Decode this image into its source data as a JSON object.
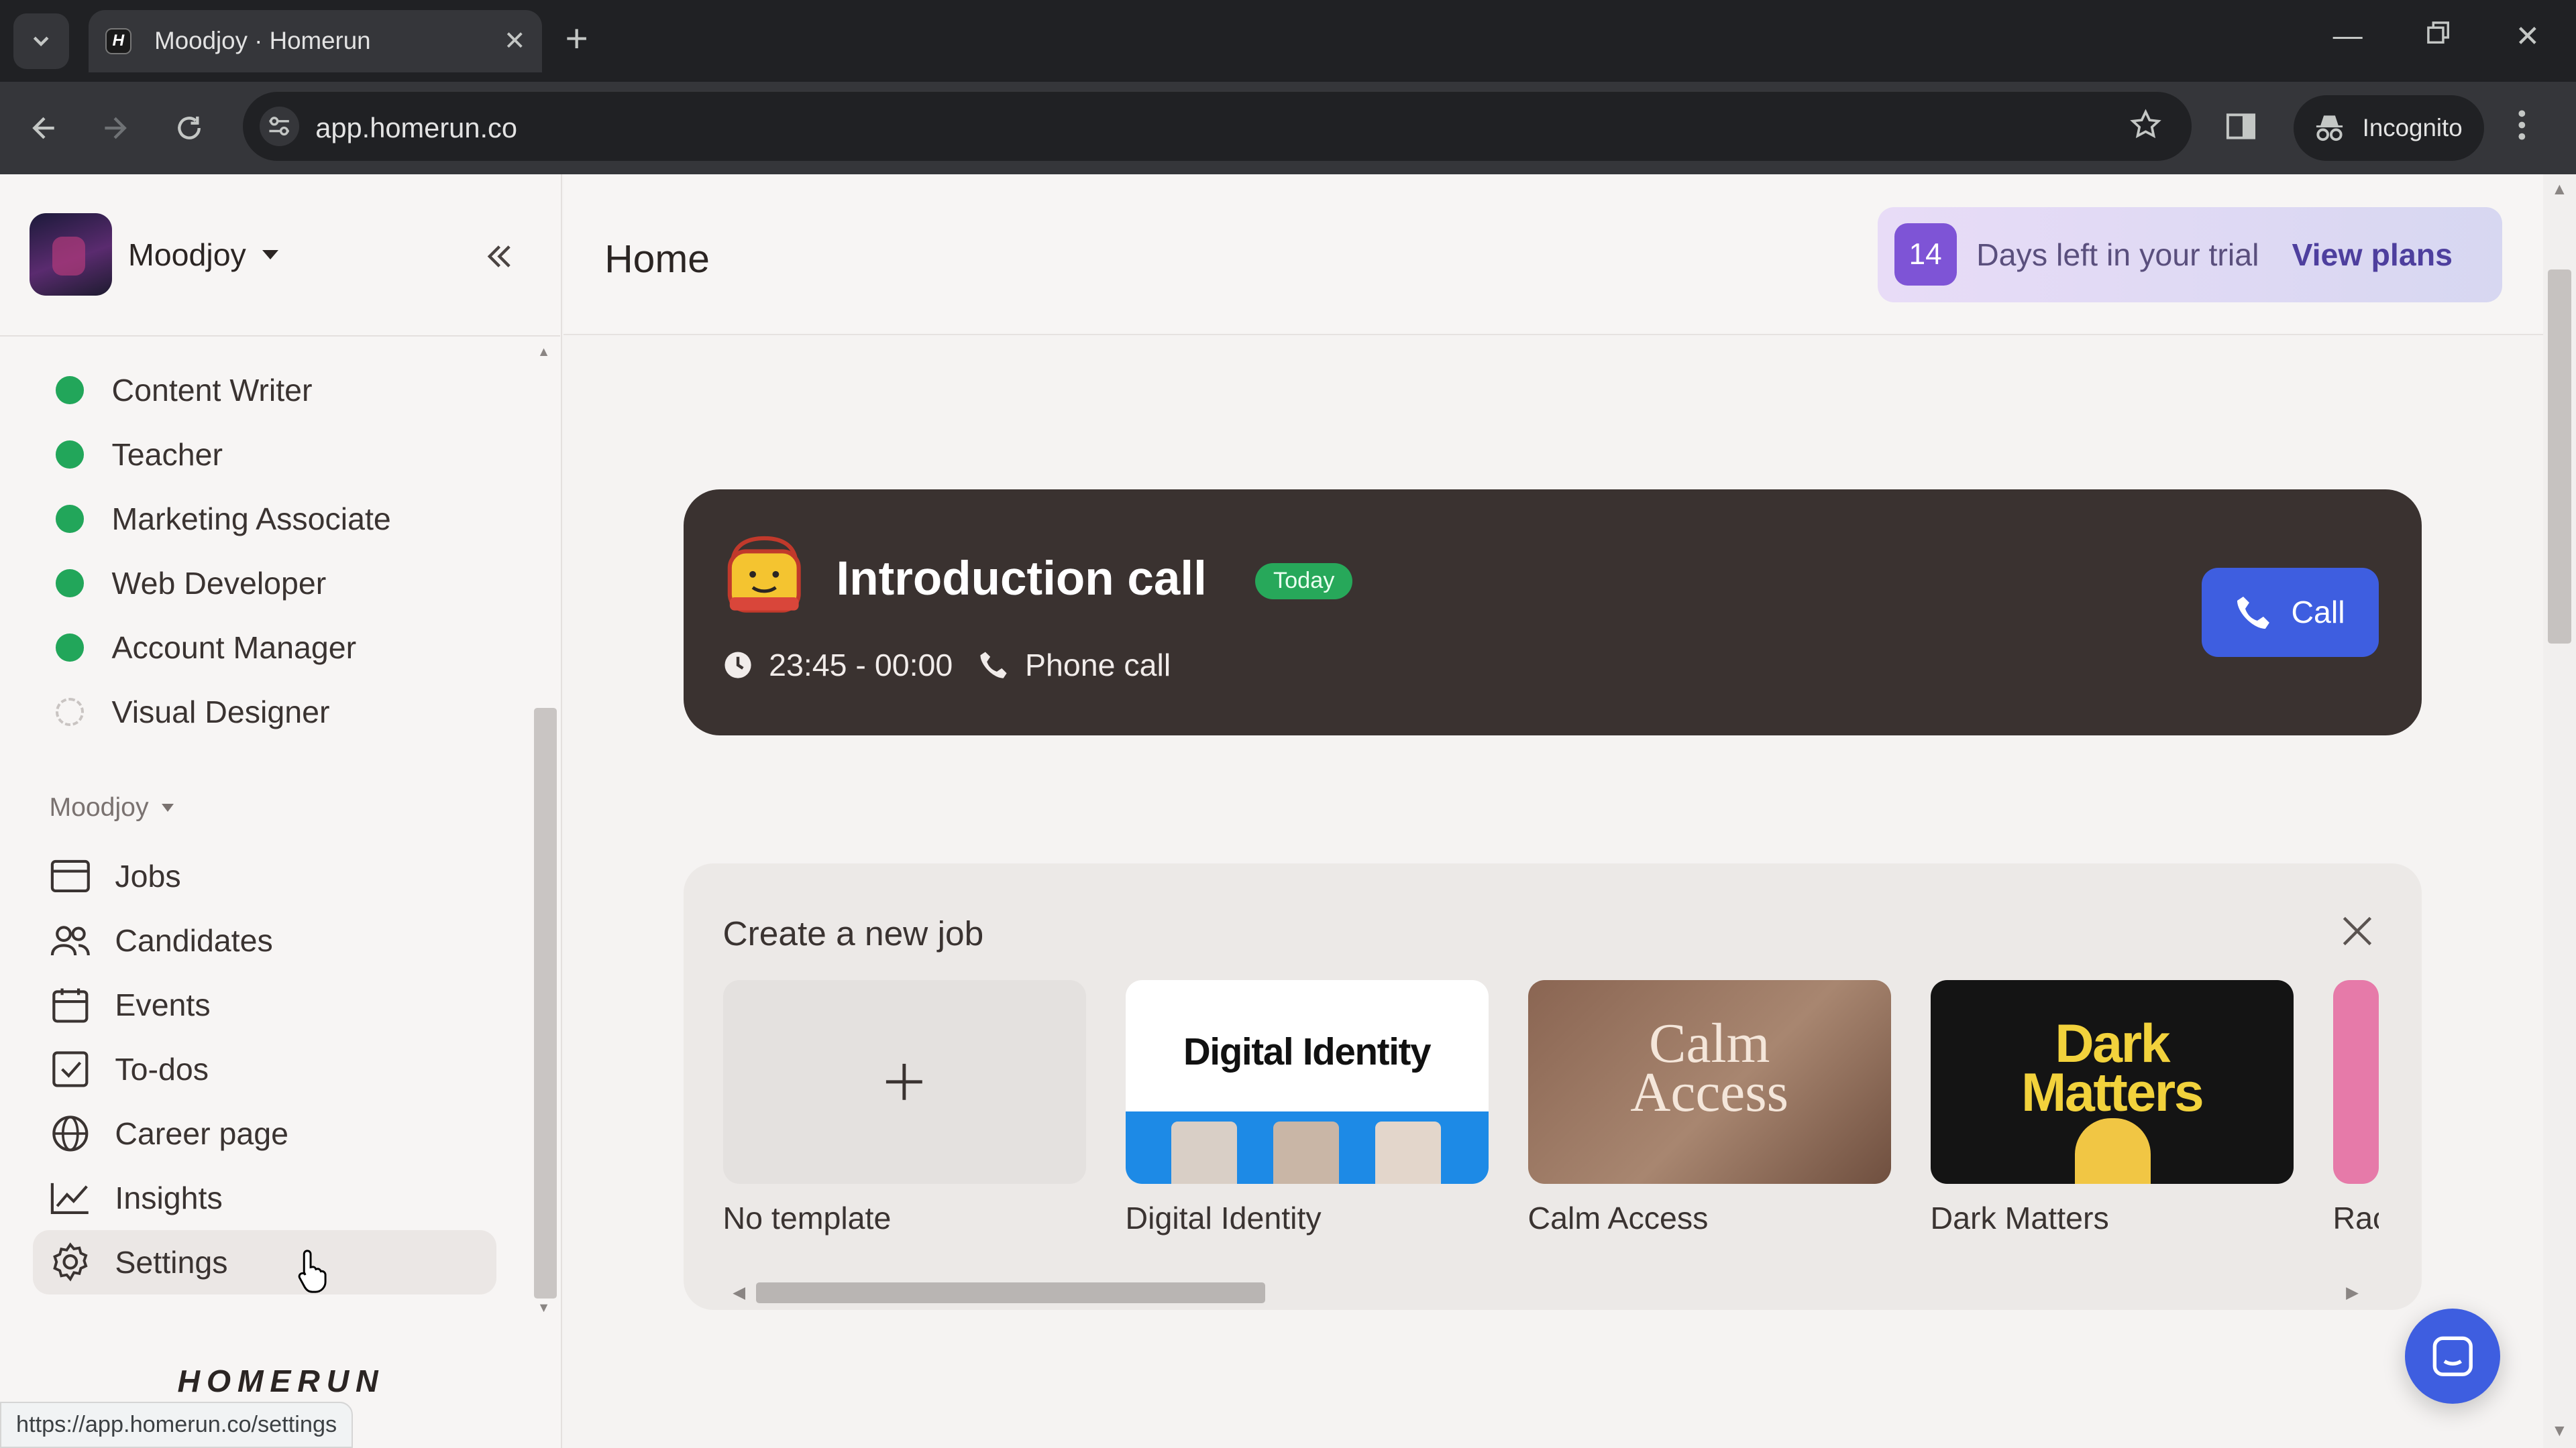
{
  "browser": {
    "tab_title": "Moodjoy · Homerun",
    "favicon_letter": "H",
    "url": "app.homerun.co",
    "incognito_label": "Incognito",
    "status_url": "https://app.homerun.co/settings"
  },
  "sidebar": {
    "workspace_name": "Moodjoy",
    "jobs": [
      {
        "label": "Content Writer",
        "status": "published"
      },
      {
        "label": "Teacher",
        "status": "published"
      },
      {
        "label": "Marketing Associate",
        "status": "published"
      },
      {
        "label": "Web Developer",
        "status": "published"
      },
      {
        "label": "Account Manager",
        "status": "published"
      },
      {
        "label": "Visual Designer",
        "status": "draft"
      }
    ],
    "group_label": "Moodjoy",
    "nav": [
      {
        "label": "Jobs",
        "icon": "jobs-icon"
      },
      {
        "label": "Candidates",
        "icon": "candidates-icon"
      },
      {
        "label": "Events",
        "icon": "calendar-icon"
      },
      {
        "label": "To-dos",
        "icon": "checkbox-icon"
      },
      {
        "label": "Career page",
        "icon": "globe-icon"
      },
      {
        "label": "Insights",
        "icon": "chart-icon"
      },
      {
        "label": "Settings",
        "icon": "gear-icon",
        "active": true
      }
    ],
    "brand": "HOMERUN"
  },
  "header": {
    "title": "Home",
    "trial_days": "14",
    "trial_text": "Days left in your trial",
    "trial_link": "View plans"
  },
  "event": {
    "title": "Introduction call",
    "badge": "Today",
    "time": "23:45 - 00:00",
    "type": "Phone call",
    "call_label": "Call"
  },
  "create_job": {
    "title": "Create a new job",
    "templates": [
      {
        "label": "No template"
      },
      {
        "label": "Digital Identity",
        "thumb_text": "Digital Identity"
      },
      {
        "label": "Calm Access",
        "thumb_text_1": "Calm",
        "thumb_text_2": "Access"
      },
      {
        "label": "Dark Matters",
        "thumb_text_1": "Dark",
        "thumb_text_2": "Matters"
      },
      {
        "label": "Rac"
      }
    ]
  },
  "colors": {
    "accent_blue": "#3e5ee0",
    "published_green": "#22a65a",
    "trial_purple": "#7e54d6",
    "event_card_bg": "#3a3230"
  }
}
